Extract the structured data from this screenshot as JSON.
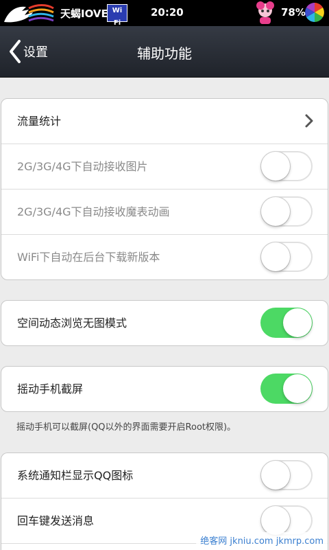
{
  "status_bar": {
    "carrier": "天蝎IOVE",
    "wifi_badge": "Wi Fi",
    "time": "20:20",
    "battery": "78%"
  },
  "nav": {
    "back_label": "设置",
    "title": "辅助功能"
  },
  "groups": [
    {
      "rows": [
        {
          "label": "流量统计",
          "control": "arrow"
        },
        {
          "label": "2G/3G/4G下自动接收图片",
          "control": "toggle",
          "on": false
        },
        {
          "label": "2G/3G/4G下自动接收魔表动画",
          "control": "toggle",
          "on": false
        },
        {
          "label": "WiFi下自动在后台下载新版本",
          "control": "toggle",
          "on": false
        }
      ]
    },
    {
      "rows": [
        {
          "label": "空间动态浏览无图模式",
          "control": "toggle",
          "on": true
        }
      ]
    },
    {
      "rows": [
        {
          "label": "摇动手机截屏",
          "control": "toggle",
          "on": true
        }
      ]
    },
    {
      "rows": [
        {
          "label": "系统通知栏显示QQ图标",
          "control": "toggle",
          "on": false
        },
        {
          "label": "回车键发送消息",
          "control": "toggle",
          "on": false
        }
      ]
    }
  ],
  "shake_note": "摇动手机可以截屏(QQ以外的界面需要开启Root权限)。",
  "watermark": "绝客网 jkniu.com jkmrp.com",
  "colors": {
    "toggle_on": "#4cd964",
    "nav_bg": "#2a2e36"
  }
}
